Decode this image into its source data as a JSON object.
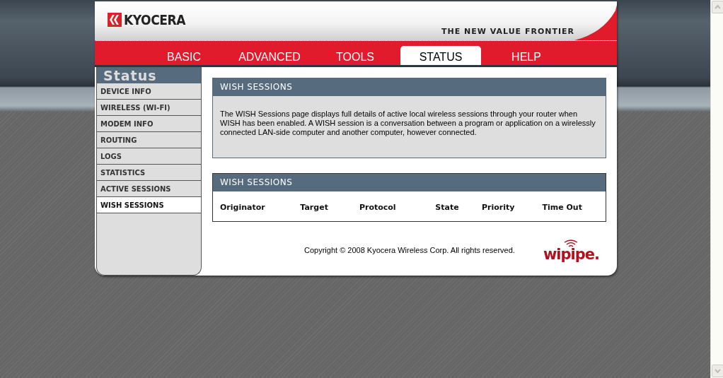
{
  "header": {
    "logo": "KYOCERA",
    "tagline": "THE NEW VALUE FRONTIER"
  },
  "tabs": [
    {
      "label": "BASIC",
      "selected": false
    },
    {
      "label": "ADVANCED",
      "selected": false
    },
    {
      "label": "TOOLS",
      "selected": false
    },
    {
      "label": "STATUS",
      "selected": true
    },
    {
      "label": "HELP",
      "selected": false
    }
  ],
  "sidebar": {
    "title": "Status",
    "items": [
      {
        "label": "DEVICE INFO",
        "selected": false
      },
      {
        "label": "WIRELESS (WI-FI)",
        "selected": false
      },
      {
        "label": "MODEM INFO",
        "selected": false
      },
      {
        "label": "ROUTING",
        "selected": false
      },
      {
        "label": "LOGS",
        "selected": false
      },
      {
        "label": "STATISTICS",
        "selected": false
      },
      {
        "label": "ACTIVE SESSIONS",
        "selected": false
      },
      {
        "label": "WISH SESSIONS",
        "selected": true
      }
    ]
  },
  "intro": {
    "title": "WISH SESSIONS",
    "text": "The WISH Sessions page displays full details of active local wireless sessions through your router when WISH has been enabled. A WISH session is a conversation between a program or application on a wirelessly connected LAN-side computer and another computer, however connected."
  },
  "table": {
    "title": "WISH SESSIONS",
    "columns": [
      "Originator",
      "Target",
      "Protocol",
      "State",
      "Priority",
      "Time Out"
    ]
  },
  "footer": {
    "copyright": "Copyright © 2008 Kyocera Wireless Corp. All rights reserved.",
    "logo": "wipipe."
  }
}
